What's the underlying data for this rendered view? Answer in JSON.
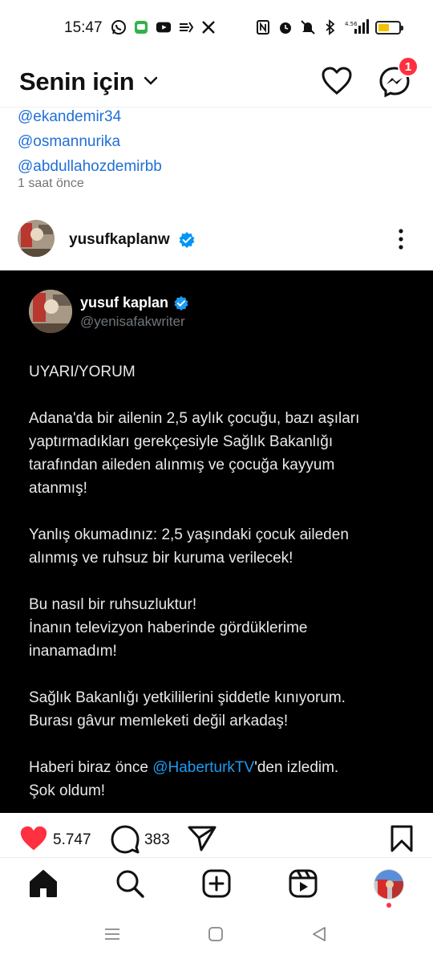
{
  "status_bar": {
    "time": "15:47",
    "left_icons": [
      "whatsapp-icon",
      "messages-icon",
      "youtube-icon",
      "tv-icon",
      "x-icon"
    ],
    "right_icons": [
      "nfc-icon",
      "alarm-icon",
      "mute-icon",
      "bluetooth-icon",
      "signal-icon",
      "battery-icon"
    ],
    "network_speed": "4.56",
    "battery_level": 0.55,
    "battery_color": "#f2c200"
  },
  "header": {
    "title": "Senin için",
    "messages_badge": "1"
  },
  "previous_post": {
    "mentions": [
      "@ekandemir34",
      "@osmannurika",
      "@abdullahozdemirbb"
    ],
    "time_ago": "1 saat önce"
  },
  "post": {
    "username": "yusufkaplanw",
    "tweet": {
      "display_name": "yusuf kaplan",
      "handle": "@yenisafakwriter",
      "paragraphs": [
        [
          "UYARI/YORUM"
        ],
        [
          "Adana'da bir ailenin 2,5 aylık çocuğu, bazı aşıları",
          "yaptırmadıkları gerekçesiyle Sağlık Bakanlığı",
          "tarafından aileden alınmış ve çocuğa kayyum",
          "atanmış!"
        ],
        [
          "Yanlış okumadınız: 2,5 yaşındaki çocuk aileden",
          "alınmış ve ruhsuz bir kuruma verilecek!"
        ],
        [
          "Bu nasıl bir ruhsuzluktur!",
          "İnanın televizyon haberinde gördüklerime",
          "inanamadım!"
        ],
        [
          "Sağlık Bakanlığı yetkililerini şiddetle kınıyorum.",
          "Burası gâvur memleketi değil arkadaş!"
        ]
      ],
      "last_paragraph": {
        "before_link": "Haberi biraz önce ",
        "link": "@HaberturkTV",
        "after_link": "'den izledim.",
        "line2": "Şok oldum!"
      }
    },
    "likes": "5.747",
    "comments": "383"
  },
  "colors": {
    "like_red": "#ff3040",
    "link_blue": "#1f6fd6",
    "tweet_link_blue": "#1d9bf0",
    "verified_blue": "#0095f6",
    "tweet_bg": "#000000"
  },
  "bottom_nav": [
    "home-icon",
    "search-icon",
    "create-icon",
    "reels-icon",
    "profile-avatar"
  ],
  "android_nav": [
    "recents-icon",
    "home-icon",
    "back-icon"
  ]
}
